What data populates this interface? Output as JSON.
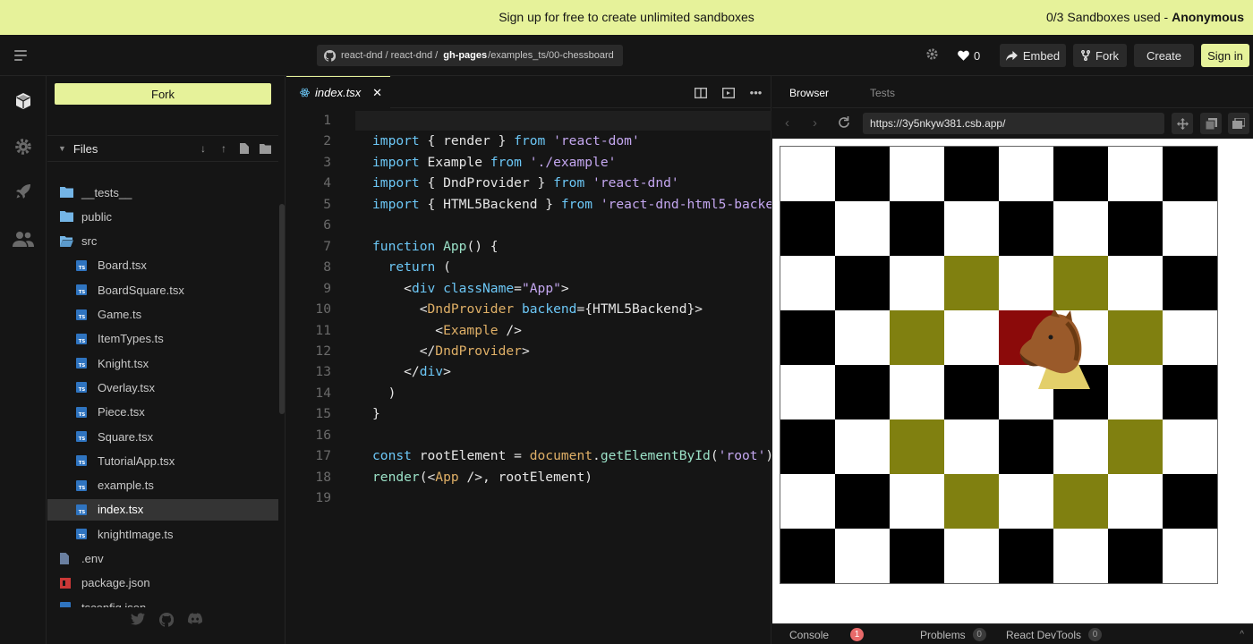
{
  "banner": {
    "message": "Sign up for free to create unlimited sandboxes",
    "used": "0/3 Sandboxes used - ",
    "user": "Anonymous"
  },
  "header": {
    "breadcrumb": {
      "owner": "react-dnd / react-dnd /",
      "branch": "gh-pages",
      "path": "/examples_ts/00-chessboard"
    },
    "likes": "0",
    "embed_label": "Embed",
    "fork_label": "Fork",
    "create_label": "Create",
    "signin_label": "Sign in"
  },
  "sidebar": {
    "fork_label": "Fork",
    "files_title": "Files",
    "tree": [
      {
        "name": "__tests__",
        "type": "folder",
        "depth": 0
      },
      {
        "name": "public",
        "type": "folder",
        "depth": 0
      },
      {
        "name": "src",
        "type": "folder-open",
        "depth": 0
      },
      {
        "name": "Board.tsx",
        "type": "ts",
        "depth": 1
      },
      {
        "name": "BoardSquare.tsx",
        "type": "ts",
        "depth": 1
      },
      {
        "name": "Game.ts",
        "type": "ts",
        "depth": 1
      },
      {
        "name": "ItemTypes.ts",
        "type": "ts",
        "depth": 1
      },
      {
        "name": "Knight.tsx",
        "type": "ts",
        "depth": 1
      },
      {
        "name": "Overlay.tsx",
        "type": "ts",
        "depth": 1
      },
      {
        "name": "Piece.tsx",
        "type": "ts",
        "depth": 1
      },
      {
        "name": "Square.tsx",
        "type": "ts",
        "depth": 1
      },
      {
        "name": "TutorialApp.tsx",
        "type": "ts",
        "depth": 1
      },
      {
        "name": "example.ts",
        "type": "ts",
        "depth": 1
      },
      {
        "name": "index.tsx",
        "type": "ts",
        "depth": 1,
        "active": true
      },
      {
        "name": "knightImage.ts",
        "type": "ts",
        "depth": 1
      },
      {
        "name": ".env",
        "type": "file",
        "depth": 0
      },
      {
        "name": "package.json",
        "type": "npm",
        "depth": 0
      },
      {
        "name": "tsconfig.json",
        "type": "ts",
        "depth": 0
      }
    ]
  },
  "editor": {
    "tab_label": "index.tsx",
    "lines": [
      [],
      [
        [
          "kw",
          "import"
        ],
        [
          "p",
          " { render } "
        ],
        [
          "kw",
          "from"
        ],
        [
          "p",
          " "
        ],
        [
          "str",
          "'react-dom'"
        ]
      ],
      [
        [
          "kw",
          "import"
        ],
        [
          "p",
          " Example "
        ],
        [
          "kw",
          "from"
        ],
        [
          "p",
          " "
        ],
        [
          "str",
          "'./example'"
        ]
      ],
      [
        [
          "kw",
          "import"
        ],
        [
          "p",
          " { DndProvider } "
        ],
        [
          "kw",
          "from"
        ],
        [
          "p",
          " "
        ],
        [
          "str",
          "'react-dnd'"
        ]
      ],
      [
        [
          "kw",
          "import"
        ],
        [
          "p",
          " { HTML5Backend } "
        ],
        [
          "kw",
          "from"
        ],
        [
          "p",
          " "
        ],
        [
          "str",
          "'react-dnd-html5-backend'"
        ]
      ],
      [],
      [
        [
          "kw",
          "function"
        ],
        [
          "p",
          " "
        ],
        [
          "fn",
          "App"
        ],
        [
          "p",
          "() {"
        ]
      ],
      [
        [
          "p",
          "  "
        ],
        [
          "kw",
          "return"
        ],
        [
          "p",
          " ("
        ]
      ],
      [
        [
          "p",
          "    <"
        ],
        [
          "kw",
          "div"
        ],
        [
          "p",
          " "
        ],
        [
          "attr",
          "className"
        ],
        [
          "p",
          "="
        ],
        [
          "str",
          "\"App\""
        ],
        [
          "p",
          ">"
        ]
      ],
      [
        [
          "p",
          "      <"
        ],
        [
          "tag",
          "DndProvider"
        ],
        [
          "p",
          " "
        ],
        [
          "attr",
          "backend"
        ],
        [
          "p",
          "={HTML5Backend}>"
        ]
      ],
      [
        [
          "p",
          "        <"
        ],
        [
          "tag",
          "Example"
        ],
        [
          "p",
          " />"
        ]
      ],
      [
        [
          "p",
          "      </"
        ],
        [
          "tag",
          "DndProvider"
        ],
        [
          "p",
          ">"
        ]
      ],
      [
        [
          "p",
          "    </"
        ],
        [
          "kw",
          "div"
        ],
        [
          "p",
          ">"
        ]
      ],
      [
        [
          "p",
          "  )"
        ]
      ],
      [
        [
          "p",
          "}"
        ]
      ],
      [],
      [
        [
          "kw",
          "const"
        ],
        [
          "p",
          " rootElement = "
        ],
        [
          "tag",
          "document"
        ],
        [
          "p",
          "."
        ],
        [
          "fn",
          "getElementById"
        ],
        [
          "p",
          "("
        ],
        [
          "str",
          "'root'"
        ],
        [
          "p",
          ")"
        ]
      ],
      [
        [
          "fn",
          "render"
        ],
        [
          "p",
          "(<"
        ],
        [
          "tag",
          "App"
        ],
        [
          "p",
          " />, rootElement)"
        ]
      ],
      []
    ]
  },
  "preview": {
    "tab_browser": "Browser",
    "tab_tests": "Tests",
    "url": "https://3y5nkyw381.csb.app/",
    "board": {
      "dark_color": "#000000",
      "light_color": "#ffffff",
      "highlight_color": "#808010",
      "source_color": "#8b0a0a",
      "highlighted": [
        [
          2,
          3
        ],
        [
          2,
          5
        ],
        [
          3,
          2
        ],
        [
          3,
          6
        ],
        [
          5,
          2
        ],
        [
          5,
          6
        ],
        [
          6,
          3
        ],
        [
          6,
          5
        ]
      ],
      "source": [
        3,
        4
      ],
      "knight": [
        4,
        4
      ]
    },
    "console_label": "Console",
    "console_count": "1",
    "problems_label": "Problems",
    "problems_count": "0",
    "devtools_label": "React DevTools",
    "devtools_count": "0"
  }
}
